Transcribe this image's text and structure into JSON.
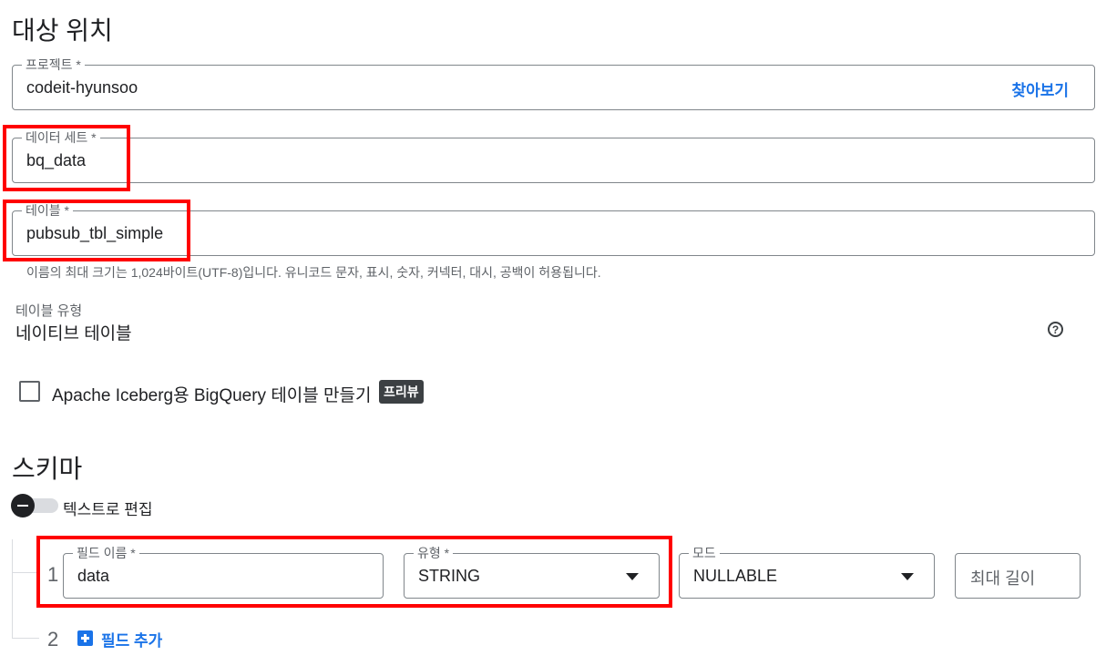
{
  "destination": {
    "heading": "대상 위치",
    "project": {
      "label": "프로젝트 *",
      "value": "codeit-hyunsoo",
      "browse": "찾아보기"
    },
    "dataset": {
      "label": "데이터 세트 *",
      "value": "bq_data"
    },
    "table": {
      "label": "테이블 *",
      "value": "pubsub_tbl_simple",
      "hint": "이름의 최대 크기는 1,024바이트(UTF-8)입니다. 유니코드 문자, 표시, 숫자, 커넥터, 대시, 공백이 허용됩니다."
    },
    "table_type": {
      "label": "테이블 유형",
      "value": "네이티브 테이블",
      "help_icon": "help-circle-icon"
    },
    "iceberg": {
      "label": "Apache Iceberg용 BigQuery 테이블 만들기",
      "badge": "프리뷰",
      "checked": false
    }
  },
  "schema": {
    "heading": "스키마",
    "edit_as_text": "텍스트로 편집",
    "rows": [
      {
        "index": "1",
        "field_name": {
          "label": "필드 이름 *",
          "value": "data"
        },
        "type": {
          "label": "유형 *",
          "value": "STRING"
        },
        "mode": {
          "label": "모드",
          "value": "NULLABLE"
        },
        "max_length": {
          "placeholder": "최대 길이"
        }
      }
    ],
    "next_index": "2",
    "add_field": "필드 추가"
  },
  "colors": {
    "accent": "#1a73e8",
    "highlight": "#ff0000",
    "badge_bg": "#3c4043"
  }
}
